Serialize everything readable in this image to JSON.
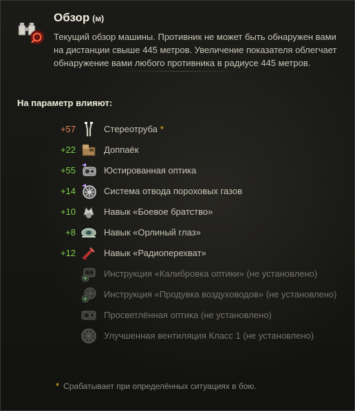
{
  "header": {
    "title": "Обзор",
    "unit": "(м)",
    "description": "Текущий обзор машины. Противник не может быть обнаружен вами на дистанции свыше 445 метров. Увеличение показателя облегчает обнаружение вами любого противника в радиусе 445 метров.",
    "icon": "binoculars-view-range-icon"
  },
  "affect_title": "На параметр влияют:",
  "items": [
    {
      "value": "+57",
      "value_color": "#e8835c",
      "name": "Стереотруба",
      "star": "*",
      "icon": "stereoscope-icon",
      "active": true
    },
    {
      "value": "+22",
      "value_color": "#7fd14b",
      "name": "Доппаёк",
      "star": "",
      "icon": "extra-ration-icon",
      "active": true
    },
    {
      "value": "+55",
      "value_color": "#7fd14b",
      "name": "Юстированная оптика",
      "star": "",
      "icon": "calibrated-optics-icon",
      "active": true
    },
    {
      "value": "+14",
      "value_color": "#7fd14b",
      "name": "Система отвода пороховых газов",
      "star": "",
      "icon": "bore-evacuator-icon",
      "active": true
    },
    {
      "value": "+10",
      "value_color": "#7fd14b",
      "name": "Навык «Боевое братство»",
      "star": "",
      "icon": "brothers-in-arms-icon",
      "active": true
    },
    {
      "value": "+8",
      "value_color": "#7fd14b",
      "name": "Навык «Орлиный глаз»",
      "star": "",
      "icon": "eagle-eye-icon",
      "active": true
    },
    {
      "value": "+12",
      "value_color": "#7fd14b",
      "name": "Навык «Радиоперехват»",
      "star": "",
      "icon": "radio-intercept-icon",
      "active": true
    },
    {
      "value": "",
      "value_color": "#77746b",
      "name": "Инструкция «Калибровка оптики» (не установлено)",
      "star": "",
      "icon": "optics-calibration-directive-icon",
      "active": false
    },
    {
      "value": "",
      "value_color": "#77746b",
      "name": "Инструкция «Продувка воздуховодов» (не установлено)",
      "star": "",
      "icon": "duct-purge-directive-icon",
      "active": false
    },
    {
      "value": "",
      "value_color": "#77746b",
      "name": "Просветлённая оптика (не установлено)",
      "star": "",
      "icon": "coated-optics-icon",
      "active": false
    },
    {
      "value": "",
      "value_color": "#77746b",
      "name": "Улучшенная вентиляция Класс 1 (не установлено)",
      "star": "",
      "icon": "improved-ventilation-icon",
      "active": false
    }
  ],
  "footnote": {
    "star": "*",
    "text": "Срабатывает при определённых ситуациях в бою."
  }
}
